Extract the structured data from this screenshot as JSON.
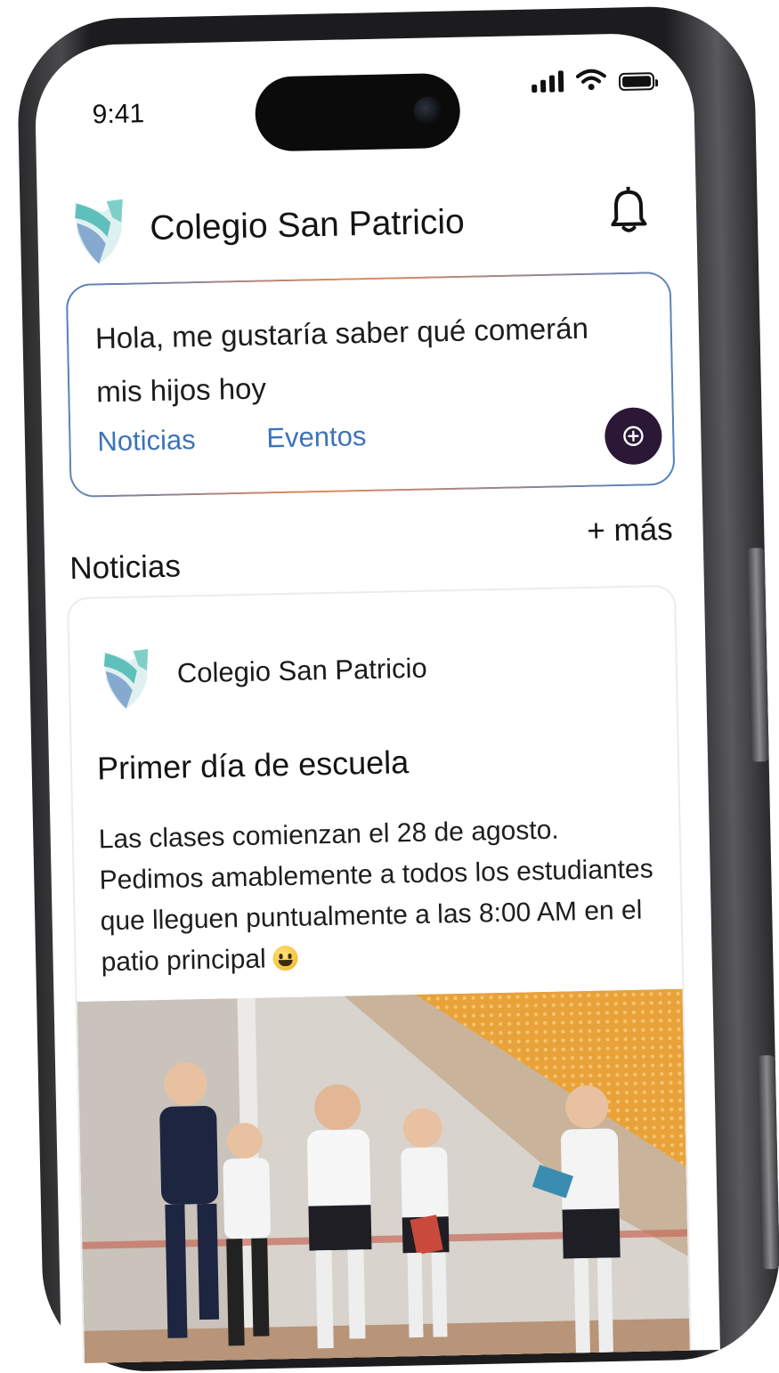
{
  "status_bar": {
    "time": "9:41"
  },
  "header": {
    "title": "Colegio San Patricio"
  },
  "assistant": {
    "prompt": "Hola, me gustaría saber qué comerán mis hijos hoy",
    "tabs": [
      "Noticias",
      "Eventos"
    ]
  },
  "news_section": {
    "title": "Noticias",
    "more_label": "+ más"
  },
  "news_card": {
    "author": "Colegio San Patricio",
    "title": "Primer día de escuela",
    "body": "Las clases comienzan el 28 de agosto. Pedimos amablemente a todos los estudiantes que lleguen puntualmente a las 8:00 AM en el patio principal",
    "image_description": ""
  },
  "colors": {
    "accent": "#3c73b8",
    "fab": "#2b1836",
    "gradient_orange": "#e38a5c"
  },
  "icons": [
    "school-shield-logo-icon",
    "bell-icon",
    "add-circle-icon",
    "signal-icon",
    "wifi-icon",
    "battery-icon",
    "smiley-emoji-icon"
  ]
}
